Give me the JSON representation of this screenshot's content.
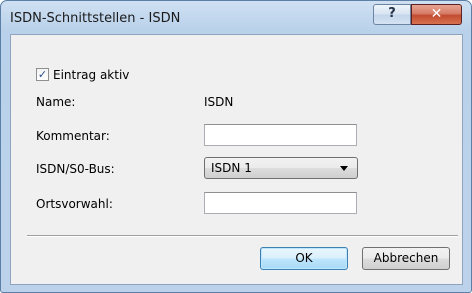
{
  "window": {
    "title": "ISDN-Schnittstellen - ISDN",
    "help_label": "?",
    "close_label": "✕"
  },
  "form": {
    "active_checkbox": {
      "label": "Eintrag aktiv",
      "checked": true,
      "mark": "✓"
    },
    "name": {
      "label": "Name:",
      "value": "ISDN"
    },
    "comment": {
      "label": "Kommentar:",
      "value": ""
    },
    "bus": {
      "label": "ISDN/S0-Bus:",
      "selected": "ISDN 1"
    },
    "area_code": {
      "label": "Ortsvorwahl:",
      "value": ""
    }
  },
  "buttons": {
    "ok": "OK",
    "cancel": "Abbrechen"
  },
  "icons": [
    "help-icon",
    "close-icon",
    "checkmark-icon",
    "chevron-down-icon"
  ]
}
